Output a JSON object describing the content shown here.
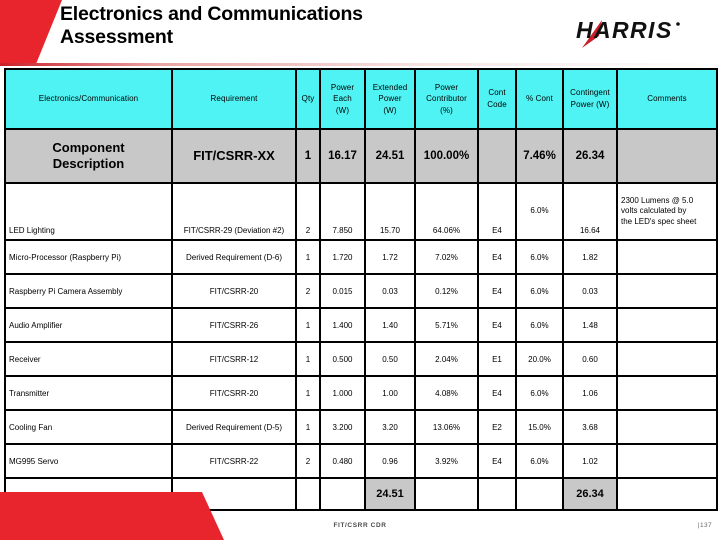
{
  "header": {
    "title": "Electronics and Communications\nAssessment",
    "logo_text": "HARRIS",
    "logo_mark": "harris-logo"
  },
  "table": {
    "columns": [
      "Electronics/Communication",
      "Requirement",
      "Qty",
      "Power\nEach\n(W)",
      "Extended\nPower\n(W)",
      "Power\nContributor\n(%)",
      "Cont\nCode",
      "% Cont",
      "Contingent\nPower (W)",
      "Comments"
    ],
    "summary_row": {
      "name": "Component\nDescription",
      "requirement": "FIT/CSRR-XX",
      "qty": "1",
      "power_each": "16.17",
      "extended_power": "24.51",
      "power_contributor": "100.00%",
      "cont_code": "",
      "pct_cont": "7.46%",
      "contingent_power": "26.34",
      "comments": ""
    },
    "rows": [
      {
        "name": "LED Lighting",
        "requirement": "FIT/CSRR-29 (Deviation #2)",
        "qty": "2",
        "power_each": "7.850",
        "extended_power": "15.70",
        "power_contributor": "64.06%",
        "cont_code": "E4",
        "pct_cont": "6.0%",
        "contingent_power": "16.64",
        "comments": "2300 Lumens @ 5.0\nvolts calculated by\nthe LED's spec sheet",
        "tall": true
      },
      {
        "name": "Micro-Processor (Raspberry Pi)",
        "requirement": "Derived Requirement (D-6)",
        "qty": "1",
        "power_each": "1.720",
        "extended_power": "1.72",
        "power_contributor": "7.02%",
        "cont_code": "E4",
        "pct_cont": "6.0%",
        "contingent_power": "1.82",
        "comments": "",
        "tall": false
      },
      {
        "name": "Raspberry Pi Camera Assembly",
        "requirement": "FIT/CSRR-20",
        "qty": "2",
        "power_each": "0.015",
        "extended_power": "0.03",
        "power_contributor": "0.12%",
        "cont_code": "E4",
        "pct_cont": "6.0%",
        "contingent_power": "0.03",
        "comments": "",
        "tall": false
      },
      {
        "name": "Audio Amplifier",
        "requirement": "FIT/CSRR-26",
        "qty": "1",
        "power_each": "1.400",
        "extended_power": "1.40",
        "power_contributor": "5.71%",
        "cont_code": "E4",
        "pct_cont": "6.0%",
        "contingent_power": "1.48",
        "comments": "",
        "tall": false
      },
      {
        "name": "Receiver",
        "requirement": "FIT/CSRR-12",
        "qty": "1",
        "power_each": "0.500",
        "extended_power": "0.50",
        "power_contributor": "2.04%",
        "cont_code": "E1",
        "pct_cont": "20.0%",
        "contingent_power": "0.60",
        "comments": "",
        "tall": false
      },
      {
        "name": "Transmitter",
        "requirement": "FIT/CSRR-20",
        "qty": "1",
        "power_each": "1.000",
        "extended_power": "1.00",
        "power_contributor": "4.08%",
        "cont_code": "E4",
        "pct_cont": "6.0%",
        "contingent_power": "1.06",
        "comments": "",
        "tall": false
      },
      {
        "name": "Cooling Fan",
        "requirement": "Derived Requirement (D-5)",
        "qty": "1",
        "power_each": "3.200",
        "extended_power": "3.20",
        "power_contributor": "13.06%",
        "cont_code": "E2",
        "pct_cont": "15.0%",
        "contingent_power": "3.68",
        "comments": "",
        "tall": false
      },
      {
        "name": "MG995 Servo",
        "requirement": "FIT/CSRR-22",
        "qty": "2",
        "power_each": "0.480",
        "extended_power": "0.96",
        "power_contributor": "3.92%",
        "cont_code": "E4",
        "pct_cont": "6.0%",
        "contingent_power": "1.02",
        "comments": "",
        "tall": false
      }
    ],
    "totals_row": {
      "name": "",
      "requirement": "",
      "qty": "",
      "power_each": "",
      "extended_power": "24.51",
      "power_contributor": "",
      "cont_code": "",
      "pct_cont": "",
      "contingent_power": "26.34",
      "comments": ""
    }
  },
  "footer": {
    "label": "FIT/CSRR CDR",
    "page": "|137"
  },
  "colors": {
    "brand_red": "#e8252c",
    "header_cyan": "#4ff3f3",
    "summary_grey": "#c8c8c8",
    "cell_grey": "#e4e4e4"
  }
}
